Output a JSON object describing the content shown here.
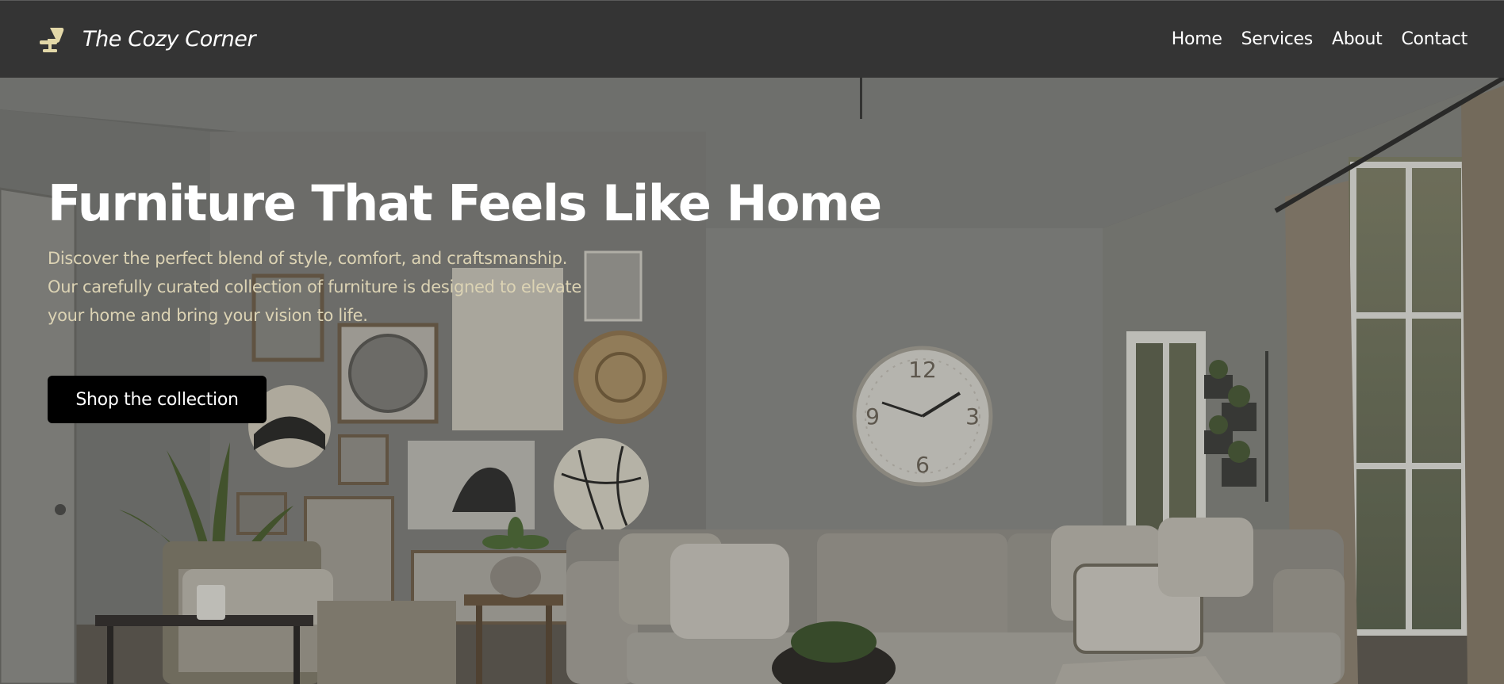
{
  "header": {
    "brand_name": "The Cozy Corner",
    "brand_icon": "chair-icon",
    "brand_icon_color": "#e3d8a8",
    "nav": [
      {
        "label": "Home"
      },
      {
        "label": "Services"
      },
      {
        "label": "About"
      },
      {
        "label": "Contact"
      }
    ]
  },
  "hero": {
    "title": "Furniture That Feels Like Home",
    "description_lines": [
      "Discover the perfect blend of style, comfort, and craftsmanship.",
      "Our carefully curated collection of furniture is designed to elevate",
      "your home and bring your vision to life."
    ],
    "cta_label": "Shop the collection",
    "description_color": "#dcd3b4"
  },
  "background_scene": {
    "clock_numerals": [
      "12",
      "3",
      "6",
      "9"
    ]
  }
}
